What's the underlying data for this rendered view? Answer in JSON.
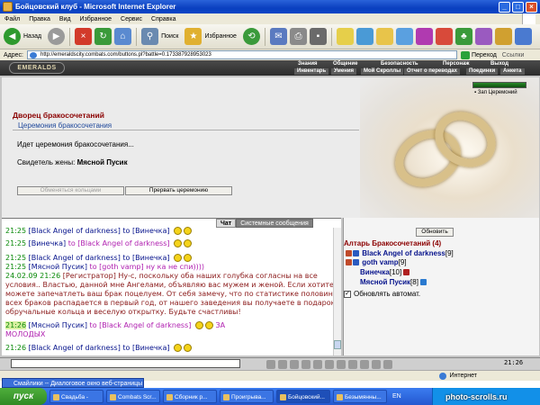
{
  "window": {
    "title": "Бойцовский клуб - Microsoft Internet Explorer"
  },
  "menu": [
    "Файл",
    "Правка",
    "Вид",
    "Избранное",
    "Сервис",
    "Справка"
  ],
  "toolbar": {
    "back": "Назад",
    "search": "Поиск",
    "favorites": "Избранное"
  },
  "address": {
    "label": "Адрес:",
    "url": "http://emeraldscity.combats.com/buttons.pl?battle=0.173387928953023",
    "go": "Переход",
    "links": "Ссылки"
  },
  "site": {
    "logo": "EMERALDS",
    "nav_top": [
      "Знания",
      "Общение",
      "Безопасность",
      "Персонаж",
      "Выход"
    ],
    "nav_sub": [
      "Инвентарь",
      "Умения",
      "Мой Скроллы",
      "Отчет о переводах",
      "Поединки",
      "Анкета"
    ],
    "exit_ceremony": "Зап Церемоний"
  },
  "hall": {
    "title": "Дворец бракосочетаний",
    "subtitle": "Церемония бракосочетания",
    "status": "Идет церемония бракосочетания...",
    "witness_label": "Свидетель жены:",
    "witness_name": "Мясной Пусик",
    "btn_exchange": "Обменяться кольцами",
    "btn_interrupt": "Прервать церемонию"
  },
  "chat": {
    "tab_chat": "Чат",
    "tab_system": "Системные сообщения",
    "messages": [
      {
        "time": "21:25",
        "from": "[Black Angel of darkness]",
        "to": " to [Винечка]",
        "text": ""
      },
      {
        "time": "21:25",
        "from": "[Винечка]",
        "to": " to [Black Angel of darkness]",
        "text": ""
      },
      {
        "time": "21:25",
        "from": "[Black Angel of darkness]",
        "to": " to [Винечка]",
        "text": ""
      },
      {
        "time": "21:25",
        "from": "[Мясной Пусик]",
        "to": " to [goth vamp]",
        "text": " ну ка не спи))))"
      },
      {
        "time": "24.02.09 21:26",
        "from": "[Регистратор]",
        "to": "",
        "text": " Ну-с, поскольку оба наших голубка согласны на все"
      },
      {
        "time": "",
        "from": "",
        "to": "",
        "text": "условия.. Властью, данной мне Ангелами, объявляю вас мужем и женой. Если хотите -"
      },
      {
        "time": "",
        "from": "",
        "to": "",
        "text": "можете запечатлеть ваш брак поцелуем. От себя замечу, что по статистике половина"
      },
      {
        "time": "",
        "from": "",
        "to": "",
        "text": "всех браков распадается в первый год, от нашего заведения вы получаете в подарок"
      },
      {
        "time": "",
        "from": "",
        "to": "",
        "text": "обручальные кольца и веселую открытку. Будьте счастливы!"
      },
      {
        "time": "21:26",
        "from": "[Мясной Пусик]",
        "to": " to [Black Angel of darkness]",
        "text": " ЗА"
      },
      {
        "time": "",
        "from": "",
        "to": "",
        "text": "МОЛОДЫХ"
      },
      {
        "time": "21:26",
        "from": "[Black Angel of darkness]",
        "to": " to [Винечка]",
        "text": ""
      }
    ]
  },
  "altar": {
    "refresh": "Обновить",
    "title": "Алтарь Бракосочетаний (4)",
    "members": [
      {
        "name": "Black Angel of darkness",
        "level": "[9]"
      },
      {
        "name": "goth vamp",
        "level": "[9]"
      },
      {
        "name": "Винечка",
        "level": "[10]"
      },
      {
        "name": "Мясной Пусик",
        "level": "[8]"
      }
    ],
    "auto_refresh": "Обновлять автомат.",
    "auto_refresh_checked": true
  },
  "clock": "21:26",
  "status": {
    "tooltip": "Смайлики -- Диалоговое окно веб-страницы",
    "zone": "Интернет"
  },
  "taskbar": {
    "start": "пуск",
    "tasks": [
      "Свадьба -",
      "Combats Scr...",
      "Сборник р...",
      "Проигрыва...",
      "Бойцовский...",
      "Безымянны..."
    ],
    "lang": "EN"
  },
  "watermark": "photo-scrolls.ru",
  "colors": {
    "title_red": "#8b0000",
    "nick_blue": "#06138c",
    "private_pink": "#b020b0",
    "time_green": "#0a8a0a"
  }
}
